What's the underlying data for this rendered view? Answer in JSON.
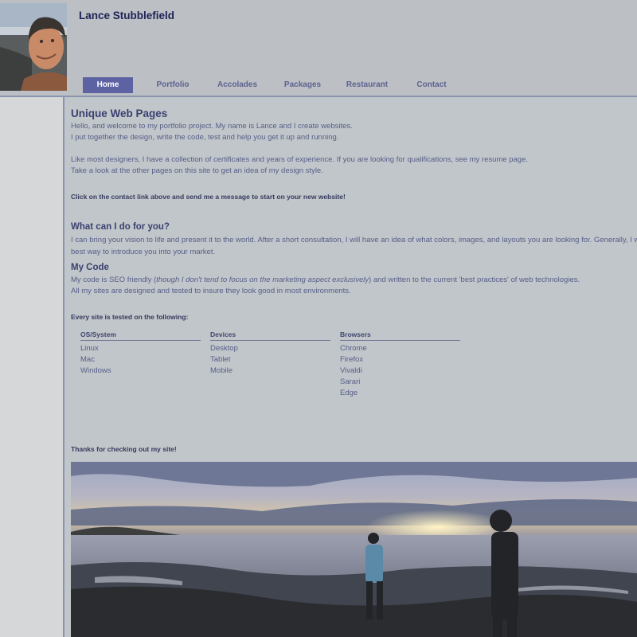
{
  "site": {
    "owner_name": "Lance Stubblefield"
  },
  "nav": {
    "items": [
      {
        "label": "Home",
        "active": true
      },
      {
        "label": "Portfolio"
      },
      {
        "label": "Accolades"
      },
      {
        "label": "Packages"
      },
      {
        "label": "Restaurant"
      },
      {
        "label": "Contact"
      }
    ]
  },
  "intro": {
    "heading": "Unique Web Pages",
    "line1": "Hello, and welcome to my portfolio project. My name is Lance and I create websites.",
    "line2": "I put together the design, write the code, test and help you get it up and running.",
    "line3": "Like most designers, I have a collection of certificates and years of experience. If you are looking for qualifications, see my resume page.",
    "line4": "Take a look at the other pages on this site to get an idea of my design style.",
    "cta": "Click on the contact link above and send me a message to start on your new website!"
  },
  "services": {
    "heading": "What can I do for you?",
    "line1": "I can bring your vision to life and present it to the world. After a short consultation, I will have an idea of what colors, images, and layouts you are looking for. Generally, I will c",
    "line2": "best way to introduce you into your market."
  },
  "code": {
    "heading": "My Code",
    "line1_before": "My code is SEO friendly (",
    "line1_italic": "though I don't tend to focus on the marketing aspect exclusively",
    "line1_after": ") and written to the current 'best practices' of web technologies.",
    "line2": "All my sites are designed and tested to insure they look good in most environments."
  },
  "testing": {
    "heading": "Every site is tested on the following:",
    "columns": [
      {
        "title": "OS/System",
        "items": [
          "Linux",
          "Mac",
          "Windows"
        ]
      },
      {
        "title": "Devices",
        "items": [
          "Desktop",
          "Tablet",
          "Mobile"
        ]
      },
      {
        "title": "Browsers",
        "items": [
          "Chrome",
          "Firefox",
          "Vivaldi",
          "Sarari",
          "Edge"
        ]
      }
    ]
  },
  "footer": {
    "thanks": "Thanks for checking out my site!"
  },
  "colors": {
    "header_bg": "#bcbfc4",
    "main_bg": "#c1c6ca",
    "nav_active_bg": "#5d62a3",
    "nav_text": "#5d6290",
    "title_text": "#1e2255",
    "body_text": "#565e88"
  }
}
